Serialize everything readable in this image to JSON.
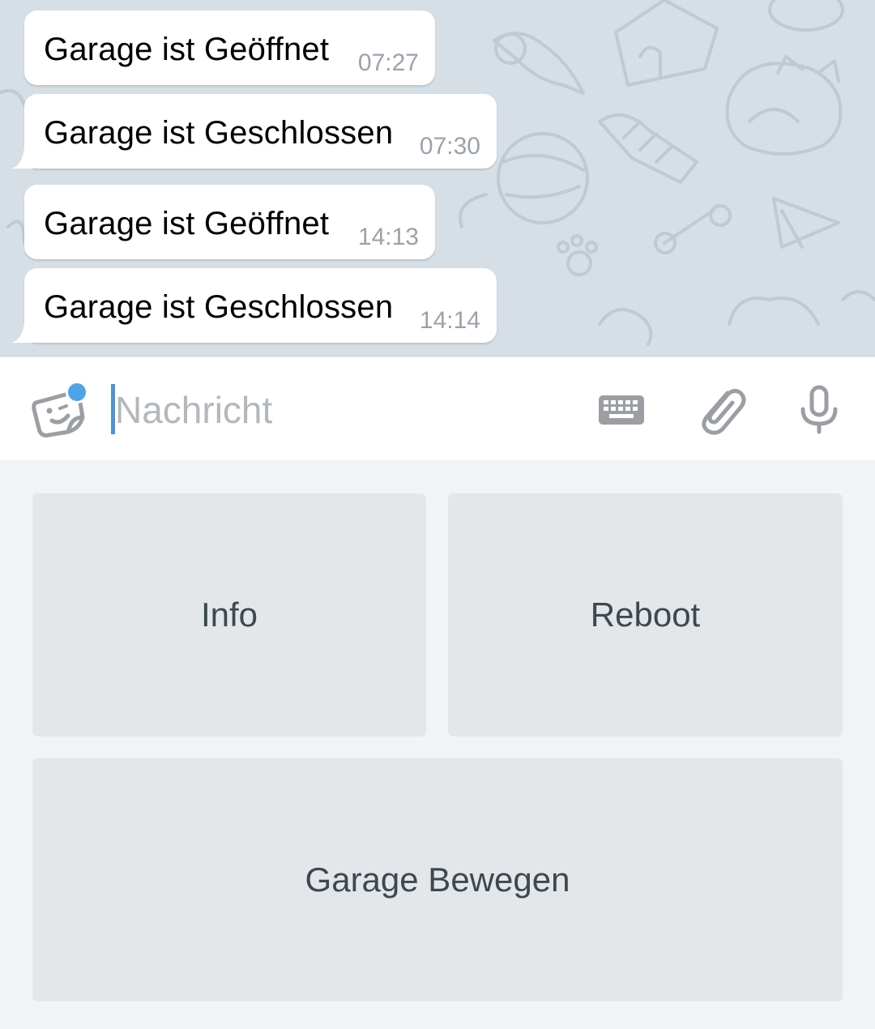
{
  "messages": [
    {
      "text": "Garage ist Geöffnet",
      "time": "07:27"
    },
    {
      "text": "Garage ist Geschlossen",
      "time": "07:30"
    },
    {
      "text": "Garage ist Geöffnet",
      "time": "14:13"
    },
    {
      "text": "Garage ist Geschlossen",
      "time": "14:14"
    }
  ],
  "composer": {
    "placeholder": "Nachricht",
    "value": ""
  },
  "icons": {
    "emoji": "sticker-emoji-icon",
    "keyboard": "keyboard-icon",
    "attach": "paperclip-icon",
    "voice": "microphone-icon"
  },
  "keyboard_buttons": {
    "info": "Info",
    "reboot": "Reboot",
    "move": "Garage Bewegen"
  },
  "colors": {
    "chat_background": "#d6dee6",
    "accent": "#4ea4e8",
    "button_background": "#e4e7ea",
    "button_text": "#3d4850",
    "time_text": "#9aa2aa"
  }
}
